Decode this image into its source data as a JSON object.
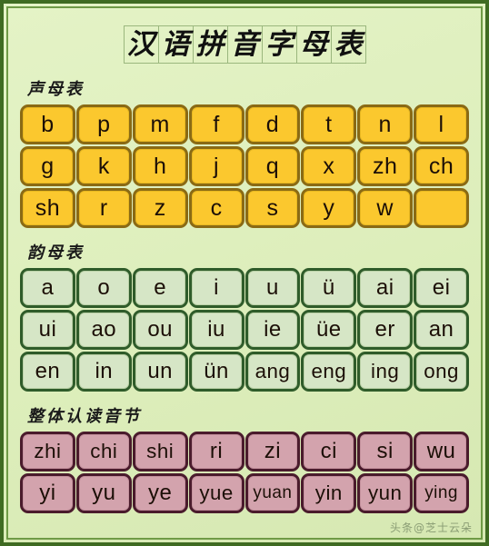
{
  "title": {
    "text": "汉语拼音字母表",
    "chars": [
      "汉",
      "语",
      "拼",
      "音",
      "字",
      "母",
      "表"
    ]
  },
  "sections": [
    {
      "id": "shengmu",
      "heading": "声母表",
      "style": "yellow",
      "rows": [
        [
          "b",
          "p",
          "m",
          "f",
          "d",
          "t",
          "n",
          "l"
        ],
        [
          "g",
          "k",
          "h",
          "j",
          "q",
          "x",
          "zh",
          "ch"
        ],
        [
          "sh",
          "r",
          "z",
          "c",
          "s",
          "y",
          "w",
          ""
        ]
      ]
    },
    {
      "id": "yunmu",
      "heading": "韵母表",
      "style": "green",
      "rows": [
        [
          "a",
          "o",
          "e",
          "i",
          "u",
          "ü",
          "ai",
          "ei"
        ],
        [
          "ui",
          "ao",
          "ou",
          "iu",
          "ie",
          "üe",
          "er",
          "an"
        ],
        [
          "en",
          "in",
          "un",
          "ün",
          "ang",
          "eng",
          "ing",
          "ong"
        ]
      ]
    },
    {
      "id": "zhengtirendu",
      "heading": "整体认读音节",
      "style": "pink",
      "rows": [
        [
          "zhi",
          "chi",
          "shi",
          "ri",
          "zi",
          "ci",
          "si",
          "wu"
        ],
        [
          "yi",
          "yu",
          "ye",
          "yue",
          "yuan",
          "yin",
          "yun",
          "ying"
        ]
      ]
    }
  ],
  "watermark": "头条@芝士云朵",
  "colors": {
    "page_background": "#e1efc2",
    "page_border": "#3f6b22",
    "yellow_fill": "#fbc82e",
    "yellow_border": "#8a6a14",
    "green_fill": "#d6e6c6",
    "green_border": "#2f5c2a",
    "pink_fill": "#d3a3ad",
    "pink_border": "#4a1b2c",
    "text": "#1c0f07"
  }
}
